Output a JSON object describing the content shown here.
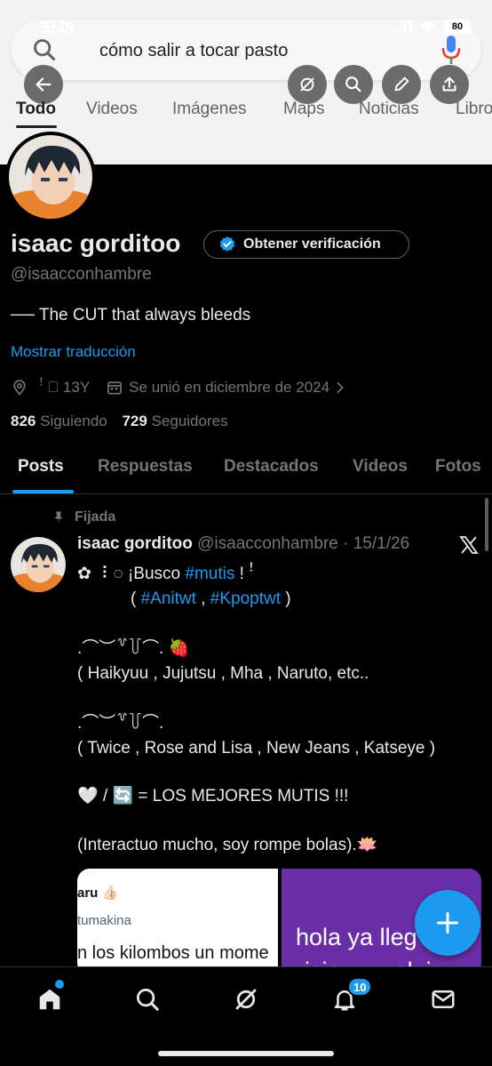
{
  "status_bar": {
    "time": "5:49",
    "battery": "80"
  },
  "google": {
    "query": "cómo salir a tocar pasto",
    "tabs": [
      {
        "label": "Todo",
        "active": true
      },
      {
        "label": "Videos"
      },
      {
        "label": "Imágenes"
      },
      {
        "label": "Maps"
      },
      {
        "label": "Noticias"
      },
      {
        "label": "Libro"
      }
    ],
    "overlay_icons": [
      "back-arrow-icon",
      "no-tracking-icon",
      "search-icon",
      "edit-icon",
      "share-icon"
    ]
  },
  "profile": {
    "display_name": "isaac gorditoo",
    "verify_label": "Obtener verificación",
    "handle": "@isaacconhambre",
    "bio": "── The CUT that always bleeds",
    "translate": "Mostrar traducción",
    "meta": {
      "location": "ꜝ ᳝ 13Y",
      "joined": "Se unió en diciembre de 2024"
    },
    "following_count": "826",
    "following_label": "Siguiendo",
    "followers_count": "729",
    "followers_label": "Seguidores",
    "tabs": [
      {
        "label": "Posts",
        "active": true
      },
      {
        "label": "Respuestas"
      },
      {
        "label": "Destacados"
      },
      {
        "label": "Videos"
      },
      {
        "label": "Fotos"
      }
    ]
  },
  "post": {
    "pinned_label": "Fijada",
    "author": "isaac gorditoo",
    "handle_date": "@isaacconhambre · 15/1/26",
    "line1_pre": "✿ ⠸ ◌ ¡Busco ",
    "line1_link": "#mutis",
    "line1_post": " !  ꜝ",
    "line2_pre": "( ",
    "line2_link1": "#Anitwt",
    "line2_mid": " , ",
    "line2_link2": "#Kpoptwt",
    "line2_post": " )",
    "line3": ".⌒︶꒷꒦⌒. 🍓",
    "line4": "( Haikyuu , Jujutsu , Mha , Naruto, etc..",
    "line5": ".⌒︶꒷꒦⌒.",
    "line6": "( Twice , Rose and Lisa , New Jeans , Katseye )",
    "line7": "🤍 / 🔄 = LOS MEJORES MUTIS !!!",
    "line8": "(Interactuo mucho, soy rompe bolas).🪷",
    "media_left": {
      "line1": "aru 👍🏻",
      "line2": "tumakina",
      "line3": "n los kilombos un mome"
    },
    "media_right": {
      "line1": "hola ya lleg",
      "line2": "isia ___ al_i"
    }
  },
  "bottom_nav": {
    "notif_count": "10"
  }
}
